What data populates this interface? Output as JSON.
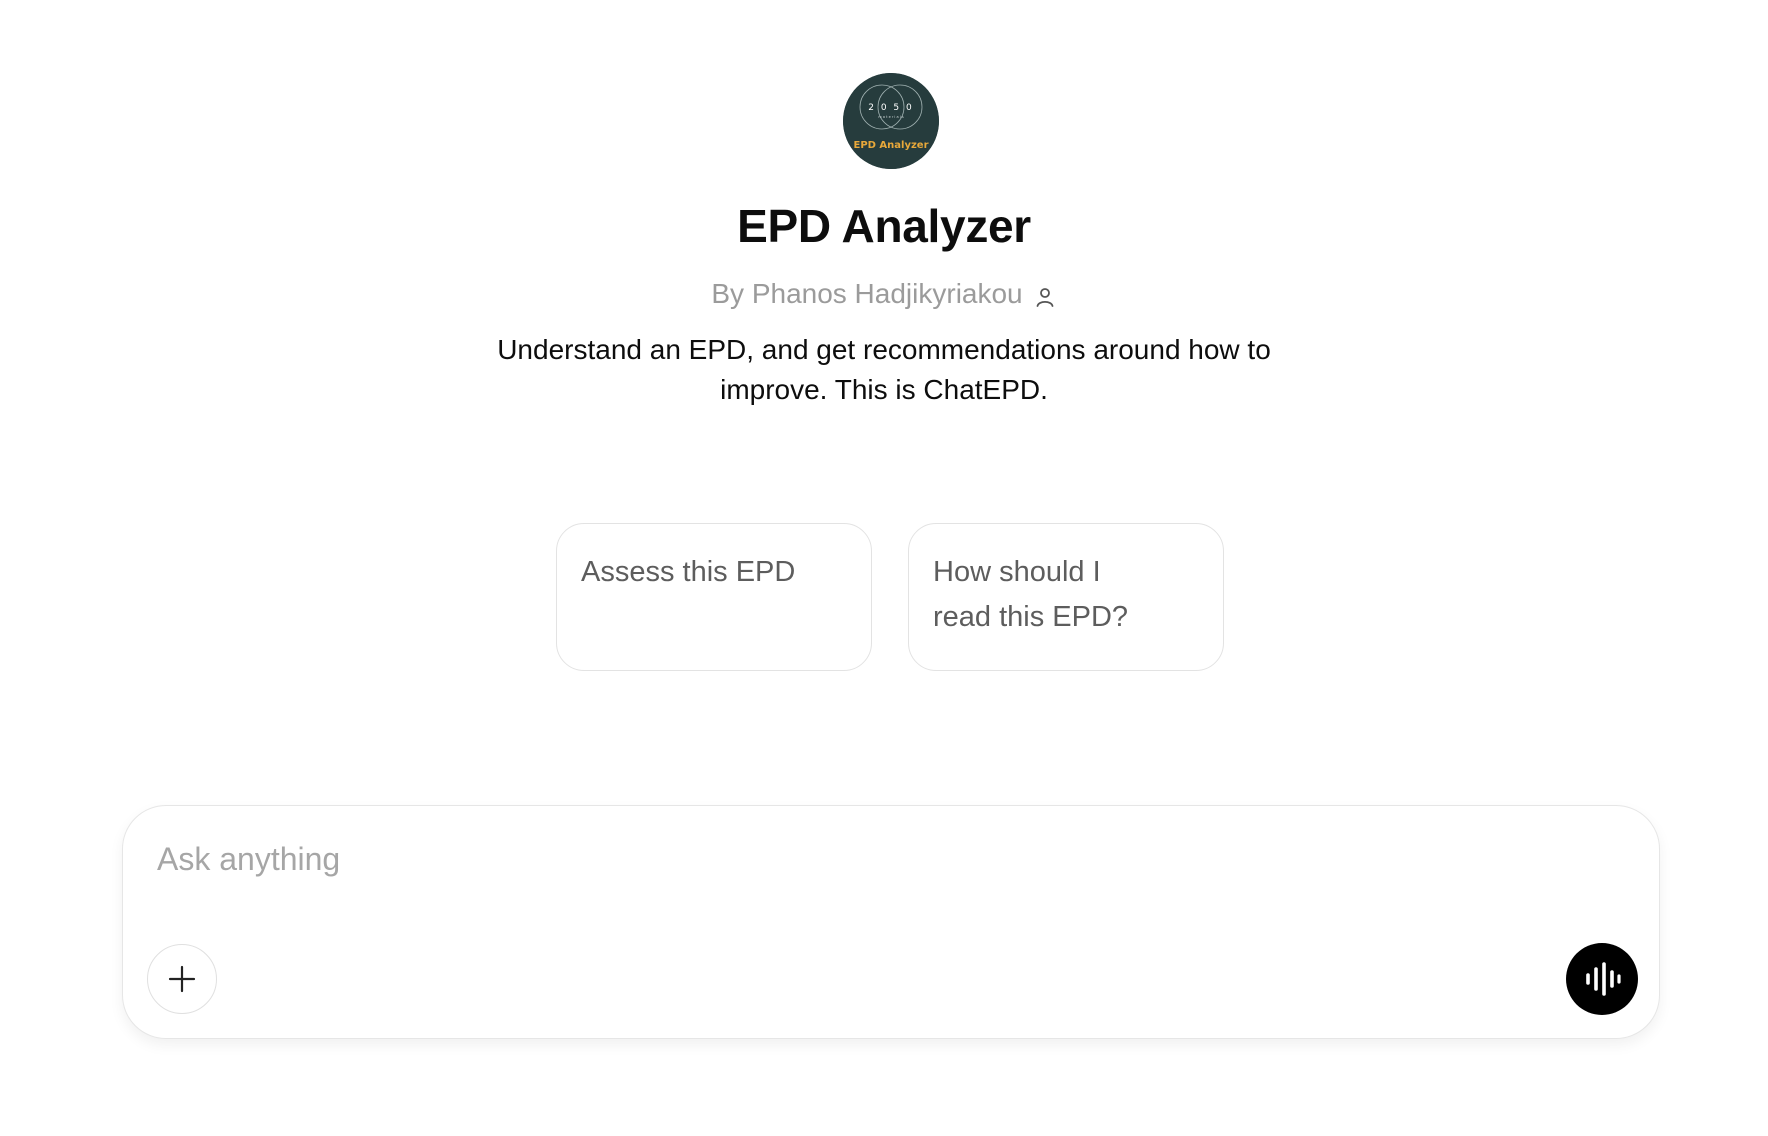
{
  "gpt": {
    "name": "EPD Analyzer",
    "byline": "By Phanos Hadjikyriakou",
    "description_line1": "Understand an EPD, and get recommendations around how to",
    "description_line2": "improve. This is ChatEPD.",
    "logo": {
      "top_text": "2 0 5 0",
      "sub_text": "m a t e r i a l s",
      "badge_text": "EPD Analyzer",
      "background_color": "#263c3d",
      "badge_color": "#e8a83a"
    }
  },
  "starters": [
    {
      "line1": "Assess this EPD",
      "line2": ""
    },
    {
      "line1": "How should I",
      "line2": "read this EPD?"
    }
  ],
  "composer": {
    "placeholder": "Ask anything",
    "value": ""
  },
  "icons": {
    "byline_icon": "person-icon",
    "add_icon": "plus-icon",
    "voice_icon": "voice-waveform-icon"
  }
}
